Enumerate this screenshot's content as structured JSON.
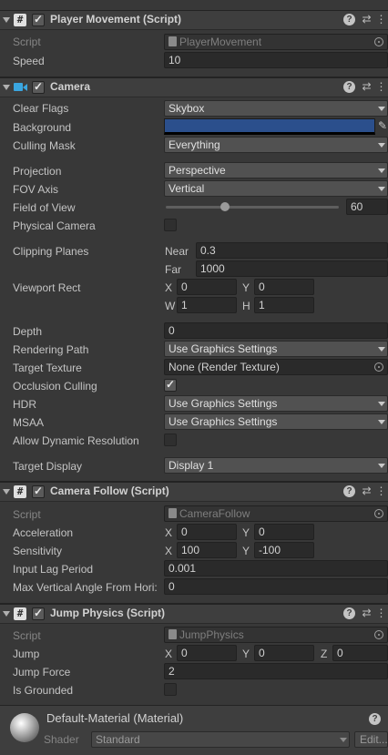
{
  "player_movement": {
    "title": "Player Movement (Script)",
    "script_label": "Script",
    "script_value": "PlayerMovement",
    "speed_label": "Speed",
    "speed_value": "10"
  },
  "camera": {
    "title": "Camera",
    "clear_flags_label": "Clear Flags",
    "clear_flags_value": "Skybox",
    "background_label": "Background",
    "background_color": "#2b4f8c",
    "culling_mask_label": "Culling Mask",
    "culling_mask_value": "Everything",
    "projection_label": "Projection",
    "projection_value": "Perspective",
    "fov_axis_label": "FOV Axis",
    "fov_axis_value": "Vertical",
    "fov_label": "Field of View",
    "fov_value": "60",
    "physical_camera_label": "Physical Camera",
    "clipping_label": "Clipping Planes",
    "near_label": "Near",
    "near_value": "0.3",
    "far_label": "Far",
    "far_value": "1000",
    "viewport_label": "Viewport Rect",
    "x_label": "X",
    "x_value": "0",
    "y_label": "Y",
    "y_value": "0",
    "w_label": "W",
    "w_value": "1",
    "h_label": "H",
    "h_value": "1",
    "depth_label": "Depth",
    "depth_value": "0",
    "rendering_path_label": "Rendering Path",
    "rendering_path_value": "Use Graphics Settings",
    "target_texture_label": "Target Texture",
    "target_texture_value": "None (Render Texture)",
    "occlusion_label": "Occlusion Culling",
    "hdr_label": "HDR",
    "hdr_value": "Use Graphics Settings",
    "msaa_label": "MSAA",
    "msaa_value": "Use Graphics Settings",
    "dynamic_res_label": "Allow Dynamic Resolution",
    "target_display_label": "Target Display",
    "target_display_value": "Display 1"
  },
  "camera_follow": {
    "title": "Camera Follow (Script)",
    "script_label": "Script",
    "script_value": "CameraFollow",
    "accel_label": "Acceleration",
    "accel_x": "0",
    "accel_y": "0",
    "sens_label": "Sensitivity",
    "sens_x": "100",
    "sens_y": "-100",
    "lag_label": "Input Lag Period",
    "lag_value": "0.001",
    "maxangle_label": "Max Vertical Angle From Hori:",
    "maxangle_value": "0",
    "x_label": "X",
    "y_label": "Y"
  },
  "jump_physics": {
    "title": "Jump Physics (Script)",
    "script_label": "Script",
    "script_value": "JumpPhysics",
    "jump_label": "Jump",
    "jump_x": "0",
    "jump_y": "0",
    "jump_z": "0",
    "x_label": "X",
    "y_label": "Y",
    "z_label": "Z",
    "force_label": "Jump Force",
    "force_value": "2",
    "grounded_label": "Is Grounded"
  },
  "material": {
    "title": "Default-Material (Material)",
    "shader_label": "Shader",
    "shader_value": "Standard",
    "edit_label": "Edit..."
  },
  "icons": {
    "help": "?",
    "presets": "⇄",
    "menu": "⋮",
    "script": "#"
  }
}
